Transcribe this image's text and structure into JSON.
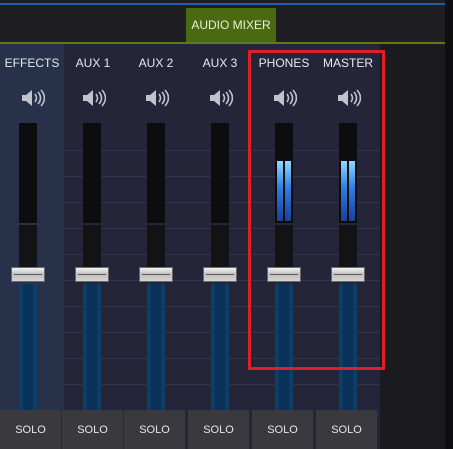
{
  "window": {
    "active_tab": "AUDIO MIXER"
  },
  "channels": [
    {
      "label": "EFFECTS",
      "solo": "SOLO",
      "meter_level": 0,
      "fader_level": 0.6
    },
    {
      "label": "AUX 1",
      "solo": "SOLO",
      "meter_level": 0,
      "fader_level": 0.6
    },
    {
      "label": "AUX 2",
      "solo": "SOLO",
      "meter_level": 0,
      "fader_level": 0.6
    },
    {
      "label": "AUX 3",
      "solo": "SOLO",
      "meter_level": 0,
      "fader_level": 0.6
    },
    {
      "label": "PHONES",
      "solo": "SOLO",
      "meter_level": 0.62,
      "fader_level": 0.6
    },
    {
      "label": "MASTER",
      "solo": "SOLO",
      "meter_level": 0.62,
      "fader_level": 0.6
    }
  ],
  "colors": {
    "accent_tab": "#4a6a12",
    "highlight_box": "#e21f26",
    "meter_blue": "#2e7de0"
  },
  "icons": {
    "channel_icon": "speaker-volume-icon"
  }
}
